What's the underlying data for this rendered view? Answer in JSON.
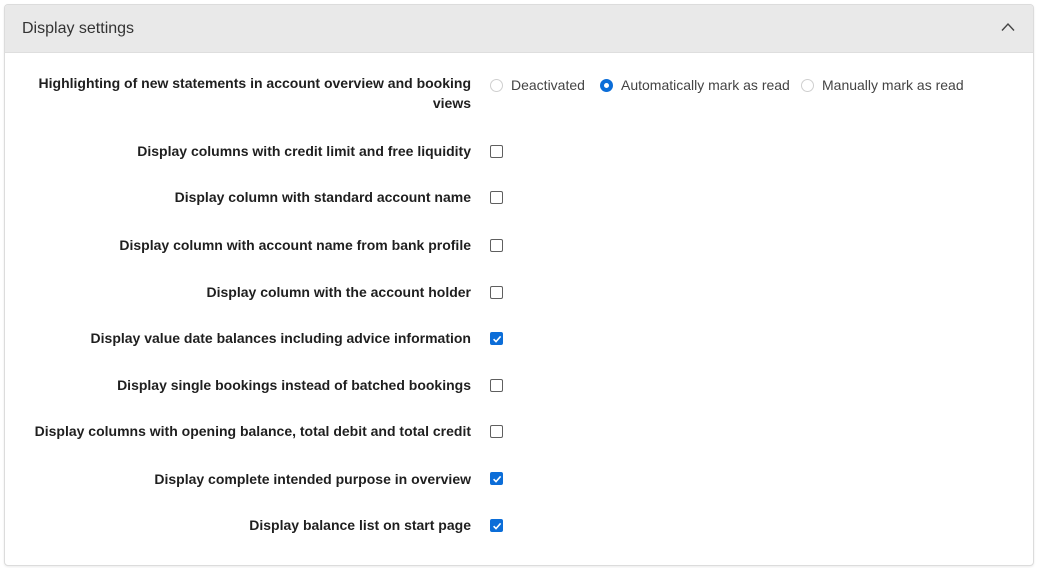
{
  "panel": {
    "title": "Display settings",
    "collapse_icon": "chevron-up-icon"
  },
  "highlighting": {
    "label": "Highlighting of new statements in account overview and booking views",
    "options": [
      {
        "label": "Deactivated",
        "selected": false
      },
      {
        "label": "Automatically mark as read",
        "selected": true
      },
      {
        "label": "Manually mark as read",
        "selected": false
      }
    ]
  },
  "settings": [
    {
      "label": "Display columns with credit limit and free liquidity",
      "checked": false
    },
    {
      "label": "Display column with standard account name",
      "checked": false
    },
    {
      "label": "Display column with account name from bank profile",
      "checked": false
    },
    {
      "label": "Display column with the account holder",
      "checked": false
    },
    {
      "label": "Display value date balances including advice information",
      "checked": true
    },
    {
      "label": "Display single bookings instead of batched bookings",
      "checked": false
    },
    {
      "label": "Display columns with opening balance, total debit and total credit",
      "checked": false
    },
    {
      "label": "Display complete intended purpose in overview",
      "checked": true
    },
    {
      "label": "Display balance list on start page",
      "checked": true
    }
  ],
  "colors": {
    "accent": "#0b6dd8",
    "header_bg": "#e9e9e9"
  }
}
